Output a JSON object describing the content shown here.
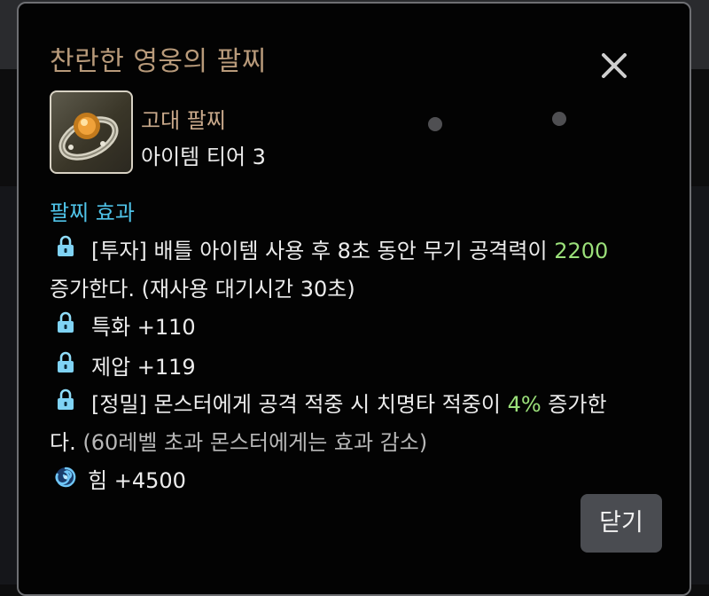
{
  "item": {
    "name": "찬란한 영웅의 팔찌",
    "grade": "고대 팔찌",
    "tier": "아이템 티어 3"
  },
  "effects": {
    "section_title": "팔찌 효과",
    "investment": {
      "prefix": "[투자] 배틀 아이템 사용 후 8초 동안 무기 공격력이 ",
      "value": "2200",
      "continuation": "증가한다. (재사용 대기시간 30초)"
    },
    "specialization": "특화 +110",
    "domination": "제압 +119",
    "precision": {
      "prefix": "[정밀] 몬스터에게 공격 적중 시 치명타 적중이 ",
      "value": "4%",
      "suffix": " 증가한",
      "continuation_start": "다.",
      "note": " (60레벨 초과 몬스터에게는 효과 감소)"
    },
    "strength": "힘 +4500"
  },
  "buttons": {
    "close_label": "닫기"
  },
  "icons": {
    "close": "close-icon",
    "lock": "lock-icon",
    "strength": "swirl-icon"
  },
  "colors": {
    "title": "#b89a7a",
    "grade": "#c9a98b",
    "section": "#4fc3e8",
    "highlight": "#9be07a",
    "lock": "#7fd3f5"
  }
}
